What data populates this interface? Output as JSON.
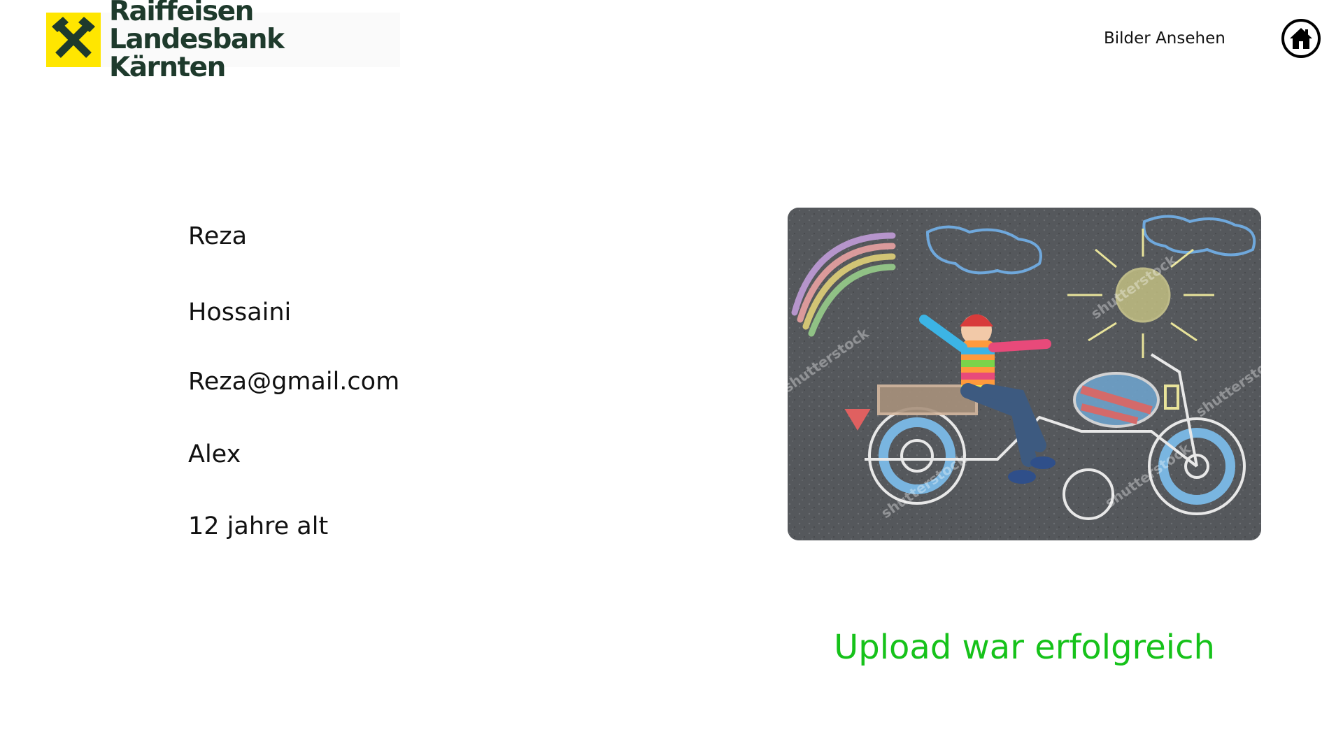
{
  "header": {
    "logo": {
      "line1": "Raiffeisen",
      "line2": "Landesbank Kärnten",
      "icon": "raiffeisen-gable-cross-icon",
      "brand_yellow": "#ffe600",
      "brand_green": "#1e3a2c"
    },
    "nav": {
      "view_pictures_label": "Bilder Ansehen"
    },
    "home_button": {
      "icon": "home-icon"
    }
  },
  "submission": {
    "first_name": "Reza",
    "last_name": "Hossaini",
    "email": "Reza@gmail.com",
    "child_name": "Alex",
    "child_age": "12 jahre alt"
  },
  "upload": {
    "image_description_icon": "uploaded-drawing-image",
    "watermark": "shutterstock",
    "status_message": "Upload war erfolgreich",
    "status_color": "#16c21a"
  }
}
